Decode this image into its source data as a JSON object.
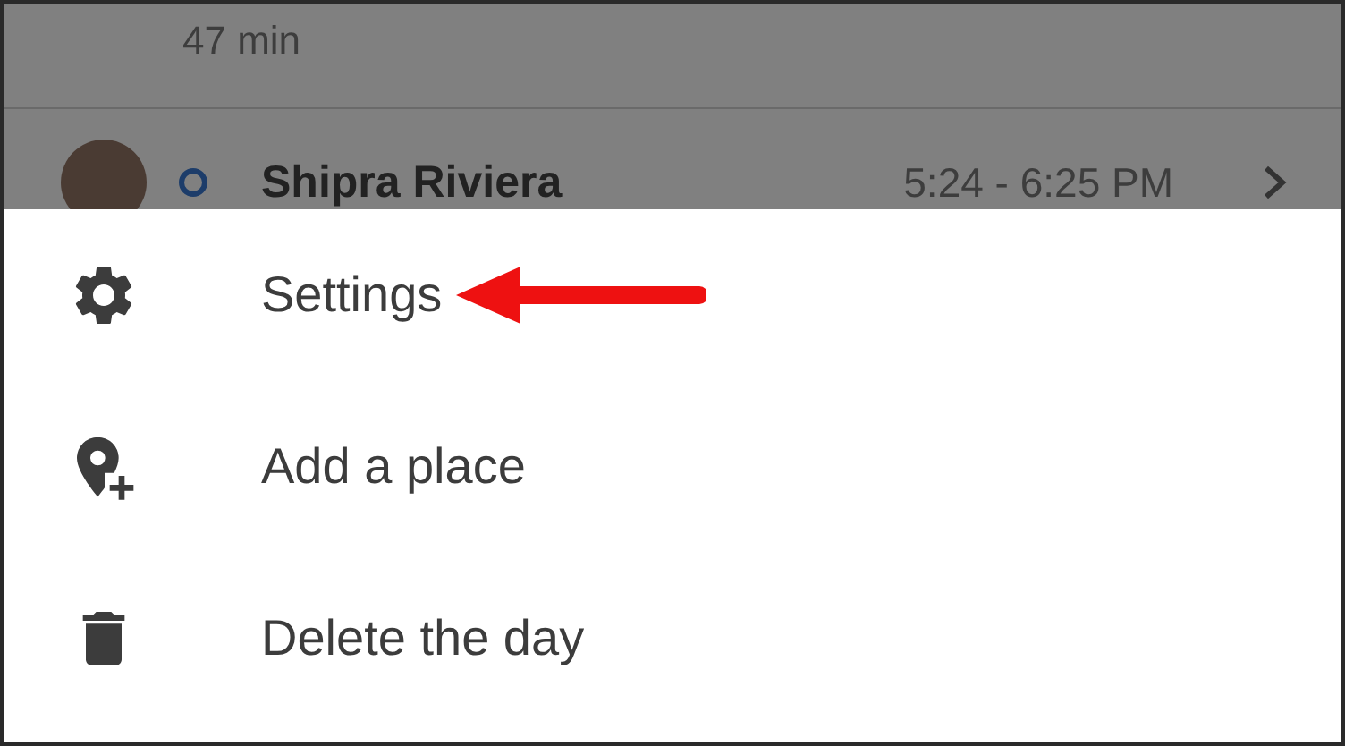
{
  "background": {
    "duration": "47 min",
    "visit": {
      "name": "Shipra Riviera",
      "time": "5:24 - 6:25 PM"
    }
  },
  "menu": [
    {
      "kind": "settings",
      "label": "Settings",
      "highlighted": true
    },
    {
      "kind": "add-place",
      "label": "Add a place",
      "highlighted": false
    },
    {
      "kind": "delete",
      "label": "Delete the day",
      "highlighted": false
    }
  ]
}
